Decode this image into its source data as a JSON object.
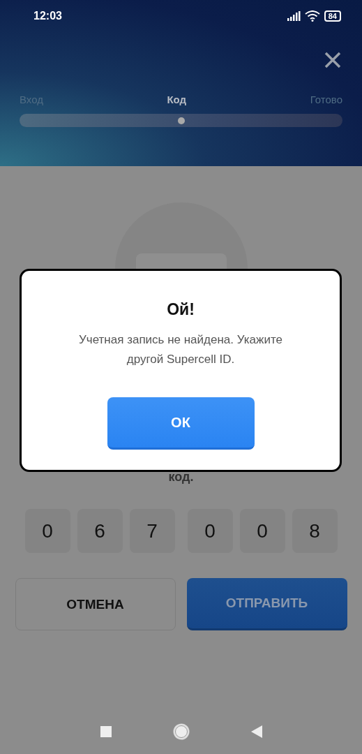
{
  "status_bar": {
    "time": "12:03",
    "battery": "84"
  },
  "steps": [
    {
      "label": "Вход",
      "selected": false
    },
    {
      "label": "Код",
      "selected": true
    },
    {
      "label": "Готово",
      "selected": false
    }
  ],
  "progress": {
    "level": 0.5
  },
  "instruction_tail": "код.",
  "code_digits": [
    "0",
    "6",
    "7",
    "0",
    "0",
    "8"
  ],
  "buttons": [
    {
      "label": "ОТМЕНА",
      "kind": "secondary"
    },
    {
      "label": "ОТПРАВИТЬ",
      "kind": "primary"
    }
  ],
  "dialog": {
    "title": "Ой!",
    "message": "Учетная запись не найдена. Укажите другой Supercell ID.",
    "button": "ОК"
  }
}
